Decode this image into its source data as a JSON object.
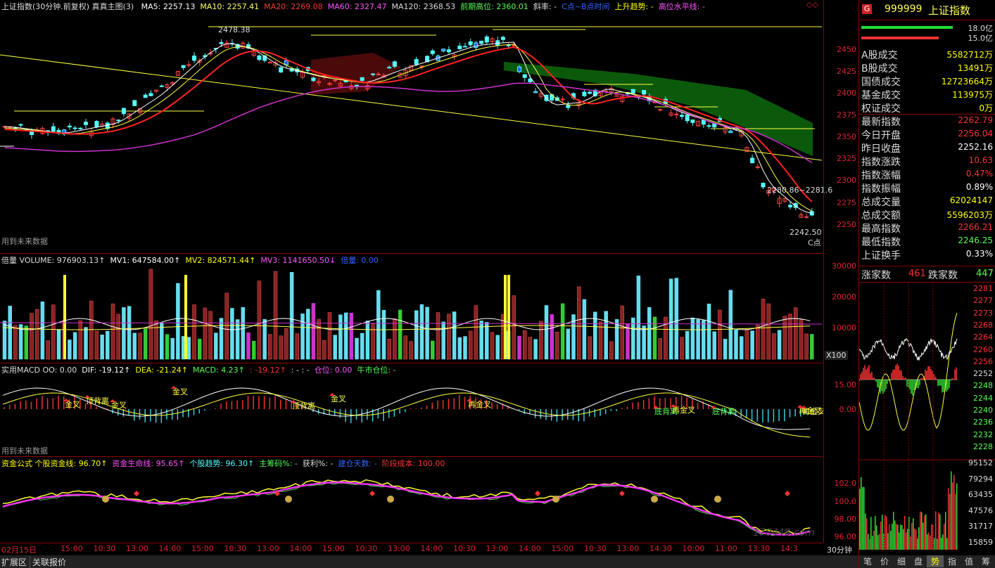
{
  "main": {
    "title": "上证指数(30分钟.前复权) 真真主图(3)",
    "indicators": [
      {
        "text": "MA5: 2257.13",
        "color": "#ffffff"
      },
      {
        "text": "MA10: 2257.41",
        "color": "#ffff66"
      },
      {
        "text": "MA20: 2269.08",
        "color": "#ff3333"
      },
      {
        "text": "MA60: 2327.47",
        "color": "#ff55ff"
      },
      {
        "text": "MA120: 2368.53",
        "color": "#dddddd"
      },
      {
        "text": "前期高位: 2360.01",
        "color": "#55ff55"
      },
      {
        "text": "斜率: -",
        "color": "#dddddd"
      },
      {
        "text": "C点~B点时间",
        "color": "#3366ff"
      },
      {
        "text": "上升趋势: -",
        "color": "#ffff00"
      },
      {
        "text": "高位水平线: -",
        "color": "#ff55ff"
      }
    ],
    "y_labels": [
      "2450",
      "2425",
      "2400",
      "2375",
      "2350",
      "2325",
      "2300",
      "2275",
      "2250"
    ],
    "annotations": {
      "high": "2478.38",
      "range": "2280.86~2281.6",
      "low": "2242.50",
      "c_point": "C点"
    },
    "future_note": "用到未来数据"
  },
  "volume": {
    "indicators": [
      {
        "text": "倍量 VOLUME: 976903.13↑",
        "color": "#dddddd"
      },
      {
        "text": "MV1: 647584.00↑",
        "color": "#ffffff"
      },
      {
        "text": "MV2: 824571.44↑",
        "color": "#ffff00"
      },
      {
        "text": "MV3: 1141650.50↓",
        "color": "#ff55ff"
      },
      {
        "text": "倍量: 0.00",
        "color": "#3366ff"
      }
    ],
    "y_labels": [
      "30000",
      "20000",
      "10000"
    ],
    "unit": "X100"
  },
  "macd": {
    "indicators": [
      {
        "text": "实用MACD OO: 0.00",
        "color": "#dddddd"
      },
      {
        "text": "DIF: -19.12↑",
        "color": "#ffffff"
      },
      {
        "text": "DEA: -21.24↑",
        "color": "#ffff00"
      },
      {
        "text": "MACD: 4.23↑",
        "color": "#55ff55"
      },
      {
        "text": ": -19.12↑",
        "color": "#ff3333"
      },
      {
        "text": ": -  : -",
        "color": "#dddddd"
      },
      {
        "text": "仓位: 0.00",
        "color": "#ff55ff"
      },
      {
        "text": "牛市仓位: -",
        "color": "#55ff55"
      }
    ],
    "y_labels": [
      "15.00",
      "0.00"
    ],
    "labels": [
      "金叉",
      "顶背离",
      "金叉",
      "金叉",
      "顶背离",
      "金叉",
      "再金叉",
      "底背离",
      "再金叉",
      "底背离",
      "再金叉",
      "再金叉"
    ],
    "future_note": "用到未来数据"
  },
  "fund": {
    "indicators": [
      {
        "text": "资金公式 个股资金线: 96.70↑",
        "color": "#ffff00"
      },
      {
        "text": "资金生命线: 95.65↑",
        "color": "#ff55ff"
      },
      {
        "text": "个股趋势: 96.30↑",
        "color": "#55ffff"
      },
      {
        "text": "主筹码%: -",
        "color": "#55ff55"
      },
      {
        "text": "获利%: -",
        "color": "#dddddd"
      },
      {
        "text": "建仓天数: -",
        "color": "#3366ff"
      },
      {
        "text": "阶段成本: 100.00",
        "color": "#ff3333"
      }
    ],
    "y_labels": [
      "102.0",
      "100.0",
      "98.00",
      "96.00"
    ]
  },
  "time_axis": [
    "02月15日",
    "15:00",
    "10:30",
    "13:00",
    "14:00",
    "15:00",
    "10:30",
    "13:00",
    "14:00",
    "15:00",
    "10:30",
    "13:00",
    "14:00",
    "10:30",
    "13:00",
    "14:00",
    "15:00",
    "10:30",
    "13:00",
    "14:30",
    "10:00",
    "11:00",
    "13:30",
    "14:3"
  ],
  "period": "30分钟",
  "bottom_tabs": [
    "扩展区",
    "关联报价"
  ],
  "quote": {
    "code": "999999",
    "name": "上证指数",
    "badge": "G",
    "bars": [
      "18.0亿",
      "15.0亿"
    ],
    "rows": [
      {
        "k": "A股成交",
        "v": "5582712万",
        "c": "#ffff00"
      },
      {
        "k": "B股成交",
        "v": "13491万",
        "c": "#ffff00"
      },
      {
        "k": "国债成交",
        "v": "12723664万",
        "c": "#ffff00"
      },
      {
        "k": "基金成交",
        "v": "113975万",
        "c": "#ffff00"
      },
      {
        "k": "权证成交",
        "v": "0万",
        "c": "#ffff00"
      },
      {
        "k": "最新指数",
        "v": "2262.79",
        "c": "#ff3333"
      },
      {
        "k": "今日开盘",
        "v": "2256.04",
        "c": "#ff3333"
      },
      {
        "k": "昨日收盘",
        "v": "2252.16",
        "c": "#ffffff"
      },
      {
        "k": "指数涨跌",
        "v": "10.63",
        "c": "#ff3333"
      },
      {
        "k": "指数涨幅",
        "v": "0.47%",
        "c": "#ff3333"
      },
      {
        "k": "指数振幅",
        "v": "0.89%",
        "c": "#ffffff"
      },
      {
        "k": "总成交量",
        "v": "62024147",
        "c": "#ffff00"
      },
      {
        "k": "总成交额",
        "v": "5596203万",
        "c": "#ffff00"
      },
      {
        "k": "最高指数",
        "v": "2266.21",
        "c": "#ff3333"
      },
      {
        "k": "最低指数",
        "v": "2246.25",
        "c": "#55ff55"
      },
      {
        "k": "上证换手",
        "v": "0.33%",
        "c": "#ffffff"
      }
    ],
    "adv_label": "涨家数",
    "adv": "461",
    "dec_label": "跌家数",
    "dec": "447",
    "mini_y": [
      "2281",
      "2277",
      "2273",
      "2268",
      "2264",
      "2260",
      "2256",
      "2252",
      "2248",
      "2244",
      "2240",
      "2236",
      "2232",
      "2228"
    ],
    "mini_vol_y": [
      "95152",
      "79294",
      "63435",
      "47576",
      "31717",
      "15859"
    ],
    "tabs": [
      "笔",
      "价",
      "细",
      "盘",
      "势",
      "指",
      "值",
      "筹"
    ]
  },
  "watermark": "178448.com"
}
